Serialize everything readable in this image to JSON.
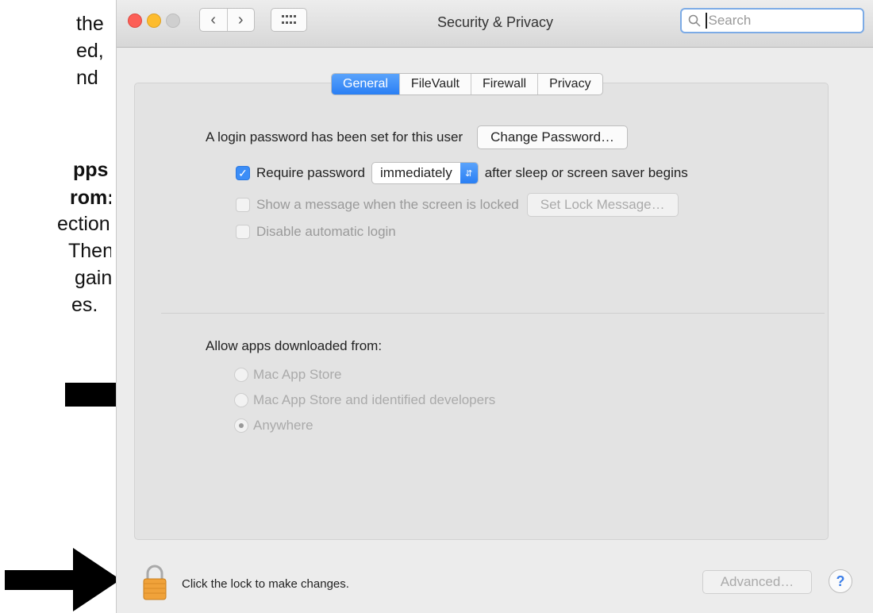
{
  "instructions": {
    "lines": [
      "the",
      "ed,",
      "nd",
      "pps",
      "rom:,",
      "ection",
      "Then",
      "gain",
      "es."
    ]
  },
  "window": {
    "title": "Security & Privacy",
    "search_placeholder": "Search",
    "nav_back_icon": "chevron-left-icon",
    "nav_forward_icon": "chevron-right-icon",
    "grid_icon": "show-all-grid-icon"
  },
  "tabs": [
    {
      "label": "General",
      "active": true
    },
    {
      "label": "FileVault",
      "active": false
    },
    {
      "label": "Firewall",
      "active": false
    },
    {
      "label": "Privacy",
      "active": false
    }
  ],
  "general": {
    "login_text": "A login password has been set for this user",
    "change_password": "Change Password…",
    "require_password": {
      "label": "Require password",
      "checked": true
    },
    "require_select": "immediately",
    "require_suffix": "after sleep or screen saver begins",
    "show_message": {
      "label": "Show a message when the screen is locked",
      "checked": false
    },
    "set_lock_message": "Set Lock Message…",
    "disable_auto_login": {
      "label": "Disable automatic login",
      "checked": false
    }
  },
  "allow_apps": {
    "heading": "Allow apps downloaded from:",
    "options": [
      {
        "label": "Mac App Store",
        "selected": false
      },
      {
        "label": "Mac App Store and identified developers",
        "selected": false
      },
      {
        "label": "Anywhere",
        "selected": true
      }
    ]
  },
  "footer": {
    "lock_label": "Click the lock to make changes.",
    "advanced": "Advanced…",
    "help": "?"
  },
  "colors": {
    "accent": "#2a7ff4",
    "window_bg": "#ececec",
    "panel_bg": "#e3e3e3",
    "lock": "#f0a23a"
  }
}
